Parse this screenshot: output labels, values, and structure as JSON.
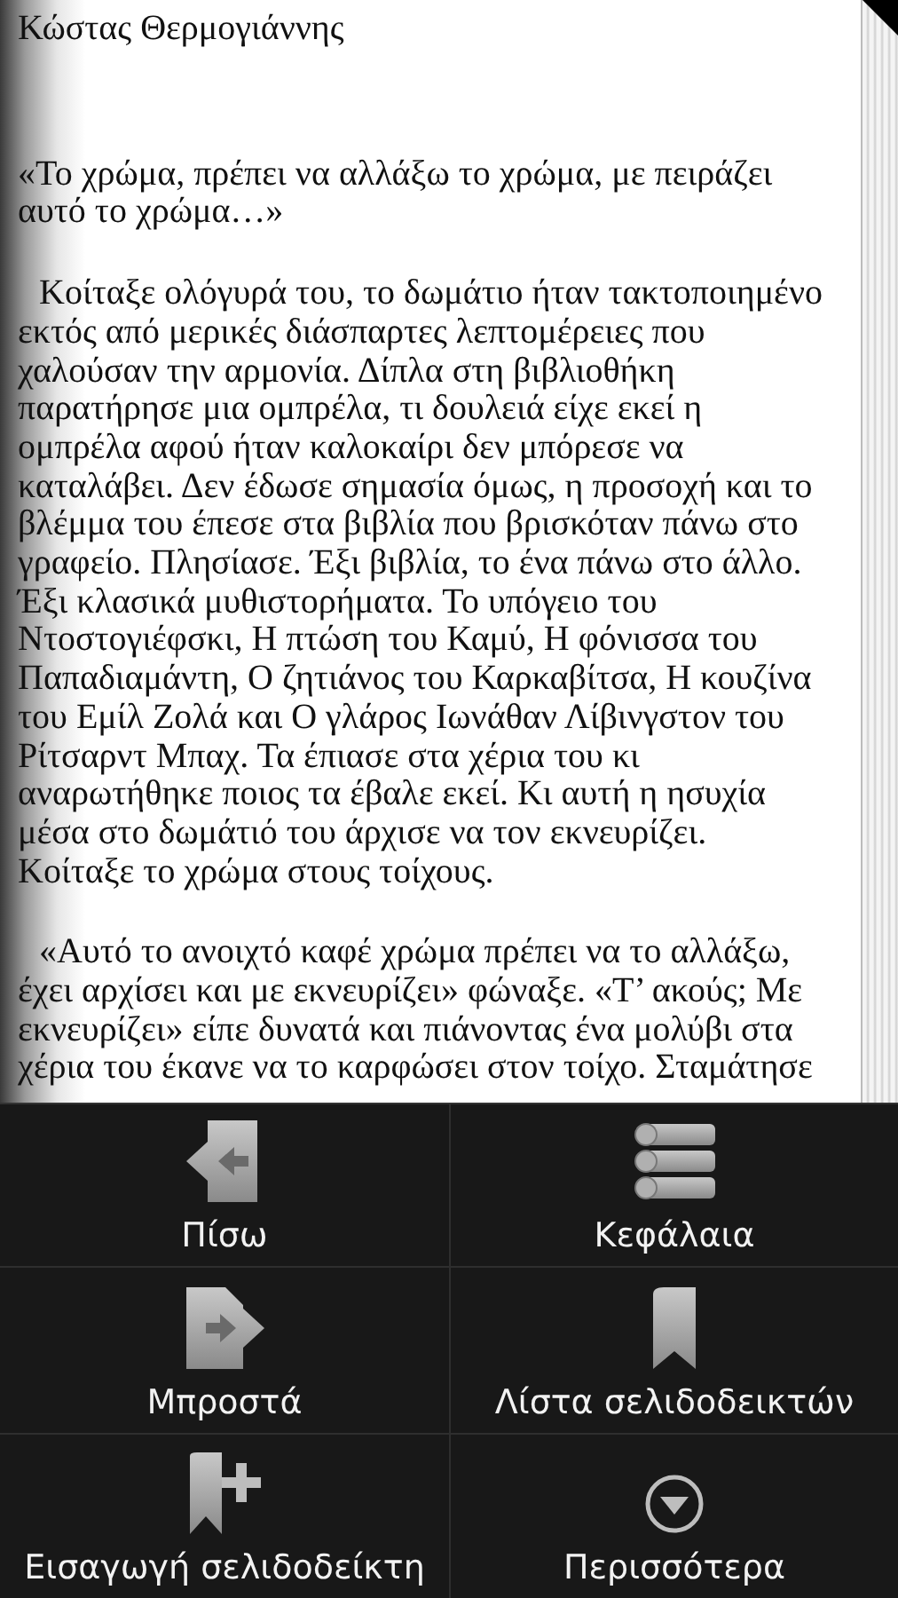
{
  "book": {
    "author": "Κώστας Θερμογιάννης",
    "paragraphs": [
      {
        "indent": false,
        "lines": [
          "«Το χρώμα, πρέπει να αλλάξω το χρώμα, με πειράζει",
          "αυτό το χρώμα…»"
        ]
      },
      {
        "indent": true,
        "lines": [
          "Κοίταξε ολόγυρά του, το δωμάτιο ήταν τακτοποιημένο",
          "εκτός από μερικές διάσπαρτες λεπτομέρειες που",
          "χαλούσαν την αρμονία. Δίπλα στη βιβλιοθήκη",
          "παρατήρησε μια ομπρέλα, τι δουλειά είχε εκεί η",
          "ομπρέλα αφού ήταν καλοκαίρι δεν μπόρεσε να",
          "καταλάβει. Δεν έδωσε σημασία όμως, η προσοχή και το",
          "βλέμμα του έπεσε στα βιβλία που βρισκόταν πάνω στο",
          "γραφείο. Πλησίασε. Έξι βιβλία, το ένα πάνω στο άλλο.",
          "Έξι κλασικά μυθιστορήματα. Το υπόγειο του",
          "Ντοστογιέφσκι, Η πτώση του Καμύ, Η φόνισσα του",
          "Παπαδιαμάντη, Ο ζητιάνος του Καρκαβίτσα, Η κουζίνα",
          "του Εμίλ Ζολά και Ο γλάρος Ιωνάθαν Λίβινγστον του",
          "Ρίτσαρντ Μπαχ. Τα έπιασε στα χέρια του κι",
          "αναρωτήθηκε ποιος τα έβαλε εκεί. Κι αυτή η ησυχία",
          "μέσα στο δωμάτιό του άρχισε να τον εκνευρίζει.",
          "Κοίταξε το χρώμα στους τοίχους."
        ]
      },
      {
        "indent": true,
        "lines": [
          "«Αυτό το ανοιχτό καφέ χρώμα πρέπει να το αλλάξω,",
          "έχει αρχίσει και με εκνευρίζει» φώναξε. «Τ’ ακούς; Με",
          "εκνευρίζει» είπε δυνατά και πιάνοντας ένα μολύβι στα",
          "χέρια του έκανε να το καρφώσει στον τοίχο. Σταμάτησε"
        ]
      }
    ]
  },
  "menu": [
    {
      "label": "Πίσω",
      "kind": "back"
    },
    {
      "label": "Κεφάλαια",
      "kind": "chapters"
    },
    {
      "label": "Μπροστά",
      "kind": "forward"
    },
    {
      "label": "Λίστα σελιδοδεικτών",
      "kind": "bookmark"
    },
    {
      "label": "Εισαγωγή σελιδοδείκτη",
      "kind": "addbookmark"
    },
    {
      "label": "Περισσότερα",
      "kind": "more"
    }
  ]
}
